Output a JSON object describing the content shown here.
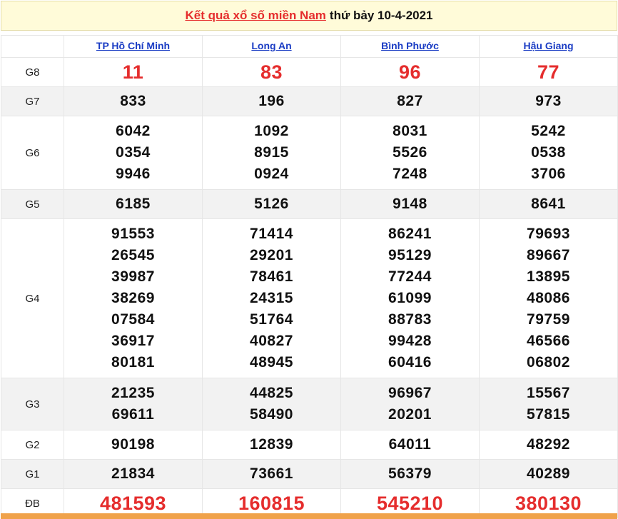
{
  "header": {
    "link_text": "Kết quả xổ số miền Nam",
    "date_text": "thứ bảy 10-4-2021"
  },
  "provinces": [
    "TP Hồ Chí Minh",
    "Long An",
    "Bình Phước",
    "Hậu Giang"
  ],
  "rows": [
    {
      "label": "G8",
      "highlight": "red",
      "shaded": false,
      "values": [
        [
          "11"
        ],
        [
          "83"
        ],
        [
          "96"
        ],
        [
          "77"
        ]
      ]
    },
    {
      "label": "G7",
      "highlight": "",
      "shaded": true,
      "values": [
        [
          "833"
        ],
        [
          "196"
        ],
        [
          "827"
        ],
        [
          "973"
        ]
      ]
    },
    {
      "label": "G6",
      "highlight": "",
      "shaded": false,
      "values": [
        [
          "6042",
          "0354",
          "9946"
        ],
        [
          "1092",
          "8915",
          "0924"
        ],
        [
          "8031",
          "5526",
          "7248"
        ],
        [
          "5242",
          "0538",
          "3706"
        ]
      ]
    },
    {
      "label": "G5",
      "highlight": "",
      "shaded": true,
      "values": [
        [
          "6185"
        ],
        [
          "5126"
        ],
        [
          "9148"
        ],
        [
          "8641"
        ]
      ]
    },
    {
      "label": "G4",
      "highlight": "",
      "shaded": false,
      "values": [
        [
          "91553",
          "26545",
          "39987",
          "38269",
          "07584",
          "36917",
          "80181"
        ],
        [
          "71414",
          "29201",
          "78461",
          "24315",
          "51764",
          "40827",
          "48945"
        ],
        [
          "86241",
          "95129",
          "77244",
          "61099",
          "88783",
          "99428",
          "60416"
        ],
        [
          "79693",
          "89667",
          "13895",
          "48086",
          "79759",
          "46566",
          "06802"
        ]
      ]
    },
    {
      "label": "G3",
      "highlight": "",
      "shaded": true,
      "values": [
        [
          "21235",
          "69611"
        ],
        [
          "44825",
          "58490"
        ],
        [
          "96967",
          "20201"
        ],
        [
          "15567",
          "57815"
        ]
      ]
    },
    {
      "label": "G2",
      "highlight": "",
      "shaded": false,
      "values": [
        [
          "90198"
        ],
        [
          "12839"
        ],
        [
          "64011"
        ],
        [
          "48292"
        ]
      ]
    },
    {
      "label": "G1",
      "highlight": "",
      "shaded": true,
      "values": [
        [
          "21834"
        ],
        [
          "73661"
        ],
        [
          "56379"
        ],
        [
          "40289"
        ]
      ]
    },
    {
      "label": "ĐB",
      "highlight": "red",
      "shaded": false,
      "values": [
        [
          "481593"
        ],
        [
          "160815"
        ],
        [
          "545210"
        ],
        [
          "380130"
        ]
      ]
    }
  ],
  "colors": {
    "accent_red": "#e52d2d",
    "link_blue": "#1a3cc4",
    "title_bg": "#fffbd9",
    "row_shade": "#f2f2f2",
    "bottom_strip": "#f0a24a"
  }
}
